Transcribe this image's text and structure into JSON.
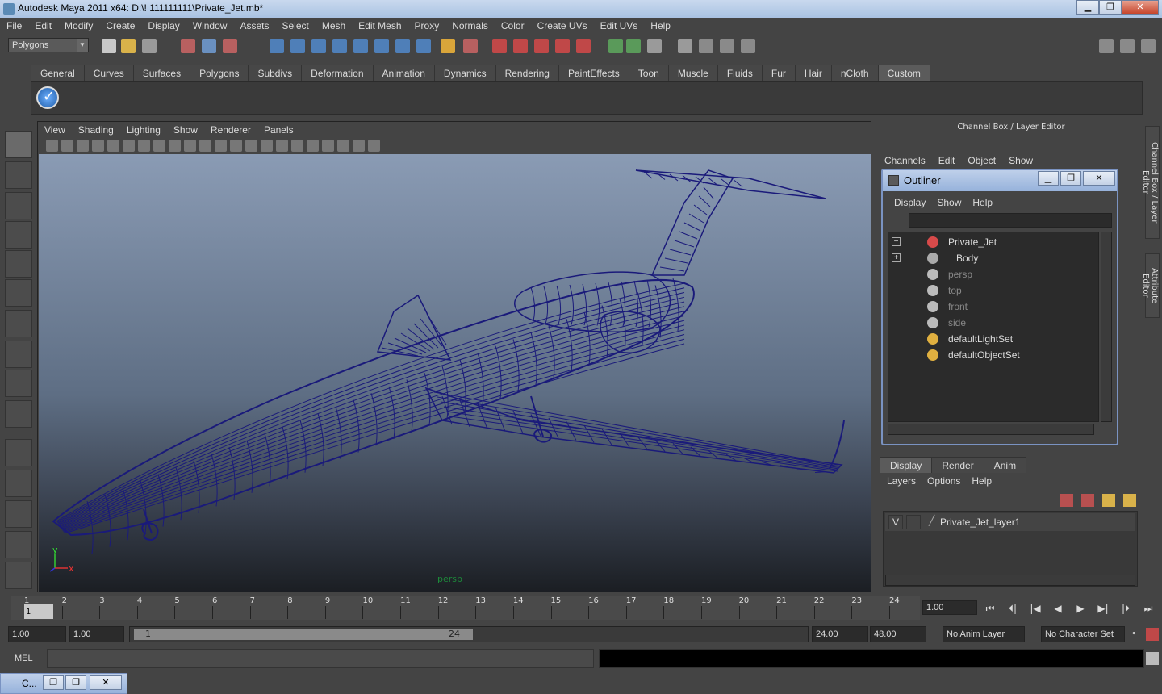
{
  "window": {
    "title": "Autodesk Maya 2011 x64: D:\\! 111111111\\Private_Jet.mb*",
    "minimize": "▁",
    "maximize": "❐",
    "close": "✕"
  },
  "menubar": [
    "File",
    "Edit",
    "Modify",
    "Create",
    "Display",
    "Window",
    "Assets",
    "Select",
    "Mesh",
    "Edit Mesh",
    "Proxy",
    "Normals",
    "Color",
    "Create UVs",
    "Edit UVs",
    "Help"
  ],
  "statusline": {
    "menu_set": "Polygons"
  },
  "shelf": {
    "tabs": [
      "General",
      "Curves",
      "Surfaces",
      "Polygons",
      "Subdivs",
      "Deformation",
      "Animation",
      "Dynamics",
      "Rendering",
      "PaintEffects",
      "Toon",
      "Muscle",
      "Fluids",
      "Fur",
      "Hair",
      "nCloth",
      "Custom"
    ],
    "active_tab": "Custom"
  },
  "viewport": {
    "menu": [
      "View",
      "Shading",
      "Lighting",
      "Show",
      "Renderer",
      "Panels"
    ],
    "camera_label": "persp",
    "axis": {
      "y": "y",
      "x": "x"
    },
    "wire_color": "#1a1a7a"
  },
  "channel_box": {
    "title": "Channel Box / Layer Editor",
    "menu": [
      "Channels",
      "Edit",
      "Object",
      "Show"
    ]
  },
  "side_tabs": [
    "Channel Box / Layer Editor",
    "Attribute Editor"
  ],
  "outliner": {
    "title": "Outliner",
    "menu": [
      "Display",
      "Show",
      "Help"
    ],
    "items": [
      {
        "label": "Private_Jet",
        "expander": "−",
        "dim": false
      },
      {
        "label": "Body",
        "expander": "+",
        "dim": false
      },
      {
        "label": "persp",
        "dim": true
      },
      {
        "label": "top",
        "dim": true
      },
      {
        "label": "front",
        "dim": true
      },
      {
        "label": "side",
        "dim": true
      },
      {
        "label": "defaultLightSet",
        "dim": false
      },
      {
        "label": "defaultObjectSet",
        "dim": false
      }
    ]
  },
  "layer_editor": {
    "tabs": [
      "Display",
      "Render",
      "Anim"
    ],
    "active_tab": "Display",
    "menu": [
      "Layers",
      "Options",
      "Help"
    ],
    "layers": [
      {
        "visible": "V",
        "name": "Private_Jet_layer1"
      }
    ]
  },
  "time_slider": {
    "ticks": [
      "1",
      "2",
      "3",
      "4",
      "5",
      "6",
      "7",
      "8",
      "9",
      "10",
      "11",
      "12",
      "13",
      "14",
      "15",
      "16",
      "17",
      "18",
      "19",
      "20",
      "21",
      "22",
      "23",
      "24"
    ],
    "current_frame": "1",
    "current_time": "1.00",
    "playback": [
      "⏮",
      "⏴|",
      "|◀",
      "◀",
      "▶",
      "▶|",
      "|⏵",
      "⏭"
    ]
  },
  "range_slider": {
    "start_time": "1.00",
    "playback_start": "1.00",
    "range_start_label": "1",
    "range_end_label": "24",
    "playback_end": "24.00",
    "end_time": "48.00",
    "anim_layer": "No Anim Layer",
    "character_set": "No Character Set"
  },
  "command_line": {
    "label": "MEL"
  },
  "minimized_window": {
    "title": "C..."
  }
}
